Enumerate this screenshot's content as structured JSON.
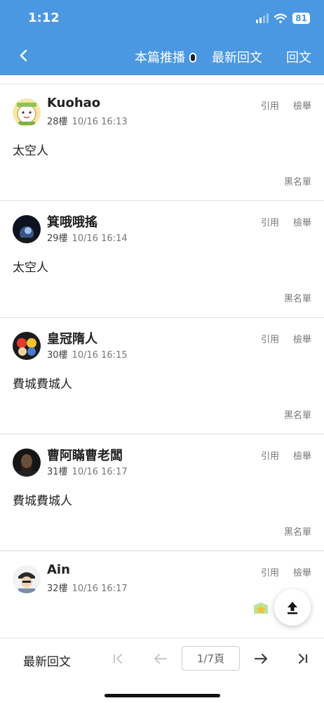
{
  "status_bar": {
    "time": "1:12",
    "battery": "81"
  },
  "header": {
    "nav_push": "本篇推播",
    "nav_latest": "最新回文",
    "nav_reply": "回文"
  },
  "posts": [
    {
      "username": "Kuohao",
      "floor": "28樓",
      "datetime": "10/16 16:13",
      "quote": "引用",
      "report": "檢舉",
      "content": "太空人",
      "blacklist": "黑名單"
    },
    {
      "username": "箕哦哦搖",
      "floor": "29樓",
      "datetime": "10/16 16:14",
      "quote": "引用",
      "report": "檢舉",
      "content": "太空人",
      "blacklist": "黑名單"
    },
    {
      "username": "皇冠隋人",
      "floor": "30樓",
      "datetime": "10/16 16:15",
      "quote": "引用",
      "report": "檢舉",
      "content": "費城費城人",
      "blacklist": "黑名單"
    },
    {
      "username": "曹阿瞞曹老闆",
      "floor": "31樓",
      "datetime": "10/16 16:17",
      "quote": "引用",
      "report": "檢舉",
      "content": "費城費城人",
      "blacklist": "黑名單"
    },
    {
      "username": "Ain",
      "floor": "32樓",
      "datetime": "10/16 16:17",
      "quote": "引用",
      "report": "檢舉",
      "content": "",
      "blacklist": ""
    }
  ],
  "bottom_bar": {
    "latest_label": "最新回文",
    "page_indicator": "1/7頁"
  },
  "icons": [
    "back-arrow-icon",
    "toggle-icon",
    "first-page-icon",
    "prev-page-icon",
    "next-page-icon",
    "last-page-icon",
    "scroll-top-icon",
    "badge-icon"
  ],
  "colors": {
    "header": "#4a97e2",
    "text": "#222222",
    "muted": "#777777"
  }
}
